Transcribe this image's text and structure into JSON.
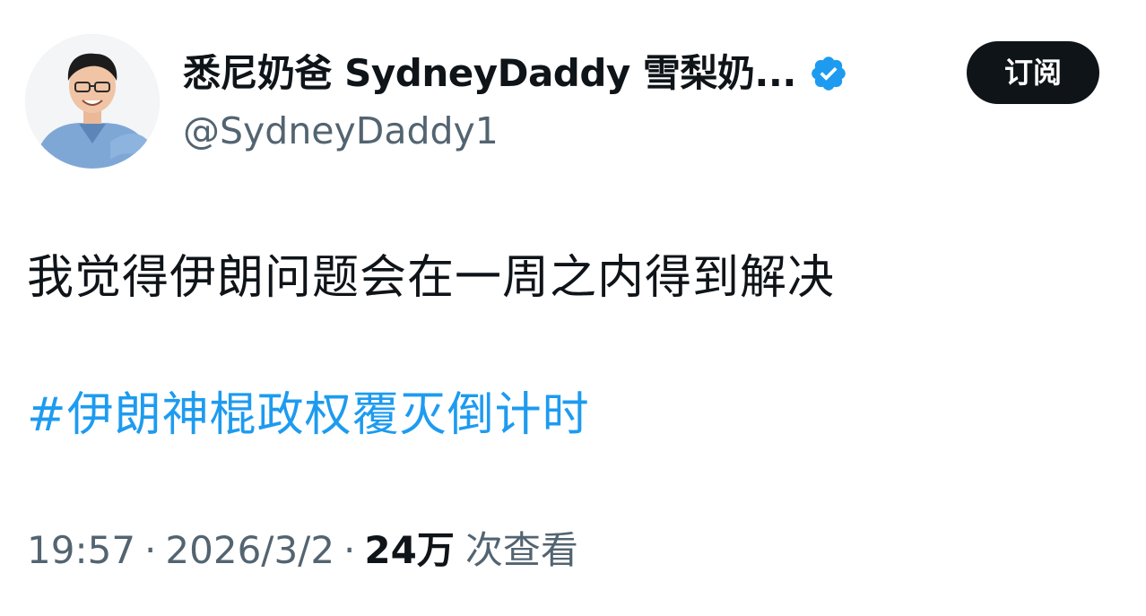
{
  "author": {
    "display_name": "悉尼奶爸 SydneyDaddy 雪梨奶...",
    "handle": "@SydneyDaddy1",
    "verified_icon": "verified-badge-icon",
    "verified_color": "#1d9bf0"
  },
  "actions": {
    "subscribe_label": "订阅"
  },
  "tweet": {
    "text": "我觉得伊朗问题会在一周之内得到解决",
    "hashtag": "#伊朗神棍政权覆灭倒计时"
  },
  "meta": {
    "time": "19:57",
    "separator": "·",
    "date": "2026/3/2",
    "views_count": "24万",
    "views_label": "次查看"
  },
  "colors": {
    "text": "#0f1419",
    "secondary": "#536471",
    "link": "#1d9bf0",
    "button_bg": "#0f1419"
  }
}
